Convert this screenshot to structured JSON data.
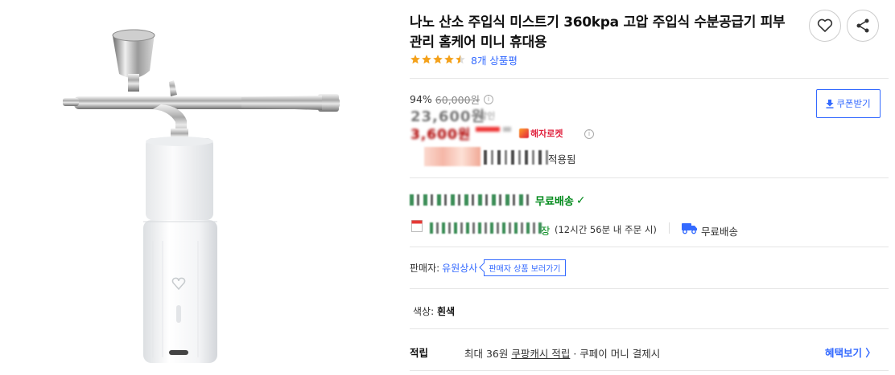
{
  "product": {
    "title": "나노 산소 주입식 미스트기 360kpa 고압 주입식 수분공급기 피부 관리 홈케어 미니 휴대용",
    "rating": 4.5,
    "review_count": "8개 상품평"
  },
  "price": {
    "discount_rate": "94%",
    "original_price": "60,000원",
    "info_icon": "ⓘ",
    "sale_price": "23,600원",
    "sale_suffix": "할인",
    "rocket_price": "3,600원",
    "rocket_badge": "해자로켓",
    "applied_label": "적용됨",
    "coupon_button": "쿠폰받기"
  },
  "delivery": {
    "free_delivery": "무료배송",
    "arrival_guarantee": "장",
    "arrival_note": "(12시간 56분 내 주문 시)",
    "free_shipping": "무료배송"
  },
  "seller": {
    "label": "판매자:",
    "name": "유원상사",
    "link": "판매자 상품 보러가기"
  },
  "option": {
    "label": "색상:",
    "value": "흰색"
  },
  "reward": {
    "label": "적립",
    "prefix": "최대 36원 ",
    "link": "쿠팡캐시 적립",
    "suffix": " · 쿠페이 머니 결제시",
    "benefit_link": "혜택보기 〉"
  },
  "icons": {
    "wish": "heart-outline-icon",
    "share": "share-icon",
    "coupon": "download-icon",
    "calendar": "calendar-icon",
    "truck": "truck-icon",
    "check": "✓"
  },
  "colors": {
    "accent": "#346aff",
    "star": "#f4a11a",
    "rocket_red": "#e0223e",
    "delivery_green": "#00891a"
  }
}
